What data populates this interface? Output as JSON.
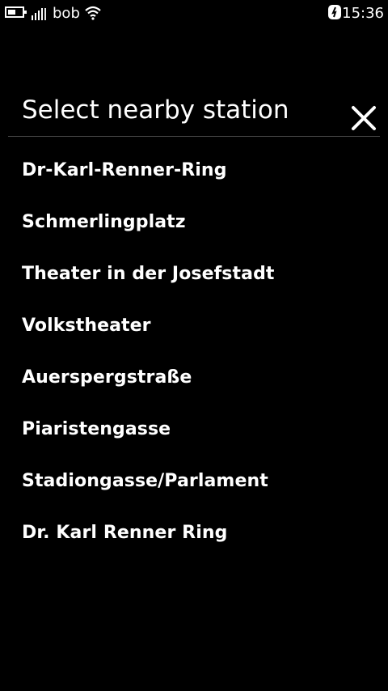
{
  "status_bar": {
    "operator": "bob",
    "time": "15:36",
    "icons": [
      "battery-icon",
      "signal-icon",
      "wifi-icon",
      "clock-app-icon"
    ]
  },
  "dialog": {
    "title": "Select nearby station",
    "close_icon": "close-icon",
    "stations": [
      {
        "label": "Dr-Karl-Renner-Ring"
      },
      {
        "label": "Schmerlingplatz"
      },
      {
        "label": "Theater in der Josefstadt"
      },
      {
        "label": "Volkstheater"
      },
      {
        "label": "Auerspergstraße"
      },
      {
        "label": "Piaristengasse"
      },
      {
        "label": "Stadiongasse/Parlament"
      },
      {
        "label": "Dr. Karl Renner Ring"
      }
    ]
  },
  "colors": {
    "background": "#000000",
    "text": "#ffffff",
    "divider": "#4a4a4a"
  }
}
